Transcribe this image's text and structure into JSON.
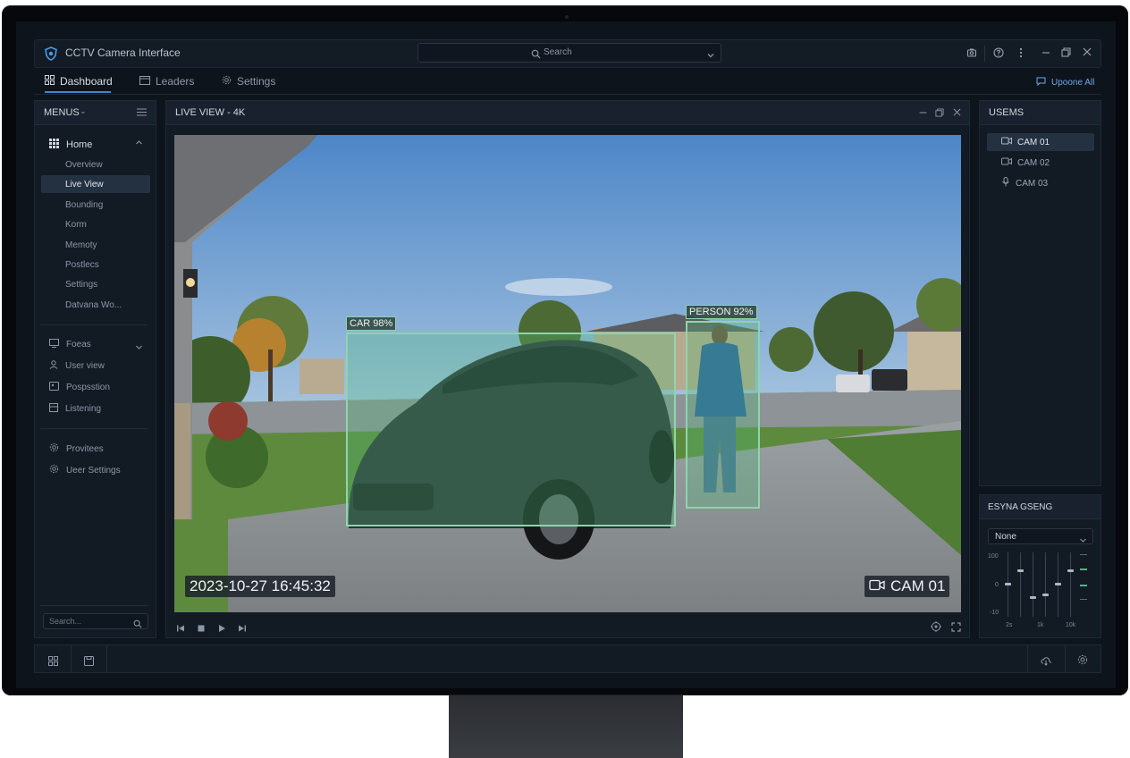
{
  "app": {
    "title": "CCTV Camera Interface",
    "search_placeholder": "Search"
  },
  "tabs": [
    {
      "label": "Dashboard",
      "active": true
    },
    {
      "label": "Leaders",
      "active": false
    },
    {
      "label": "Settings",
      "active": false
    }
  ],
  "tabs_right_label": "Upoone All",
  "sidebar": {
    "title": "MENUS",
    "home": {
      "label": "Home",
      "children": [
        "Overview",
        "Live View",
        "Bounding",
        "Korm",
        "Memoty",
        "Postlecs",
        "Settings",
        "Datvana Wo..."
      ],
      "selected": "Live View"
    },
    "group2": [
      "Foeas",
      "User view",
      "Pospsstion",
      "Listening"
    ],
    "group3": [
      "Provitees",
      "Ueer Settings"
    ],
    "search_placeholder": "Search..."
  },
  "liveview": {
    "title": "LIVE VIEW - 4K",
    "timestamp": "2023-10-27 16:45:32",
    "cam_label": "CAM 01",
    "detections": [
      {
        "label": "CAR 98%"
      },
      {
        "label": "PERSON 92%"
      }
    ]
  },
  "right_panel": {
    "title": "USEMS",
    "cameras": [
      {
        "label": "CAM 01",
        "selected": true,
        "icon": "video-icon"
      },
      {
        "label": "CAM 02",
        "selected": false,
        "icon": "video-icon"
      },
      {
        "label": "CAM 03",
        "selected": false,
        "icon": "mic-icon"
      }
    ]
  },
  "eq_panel": {
    "title": "ESYNA GSENG",
    "select_value": "None",
    "y_labels": [
      "100",
      "0",
      "-10"
    ],
    "x_labels": [
      "2s",
      "1k",
      "10k"
    ],
    "slider_levels": [
      0.5,
      0.72,
      0.28,
      0.33,
      0.5,
      0.72
    ],
    "colors": {
      "accent": "#3d87d6",
      "bbox": "#8fd4ab",
      "meter": "#3fbf7f"
    }
  }
}
